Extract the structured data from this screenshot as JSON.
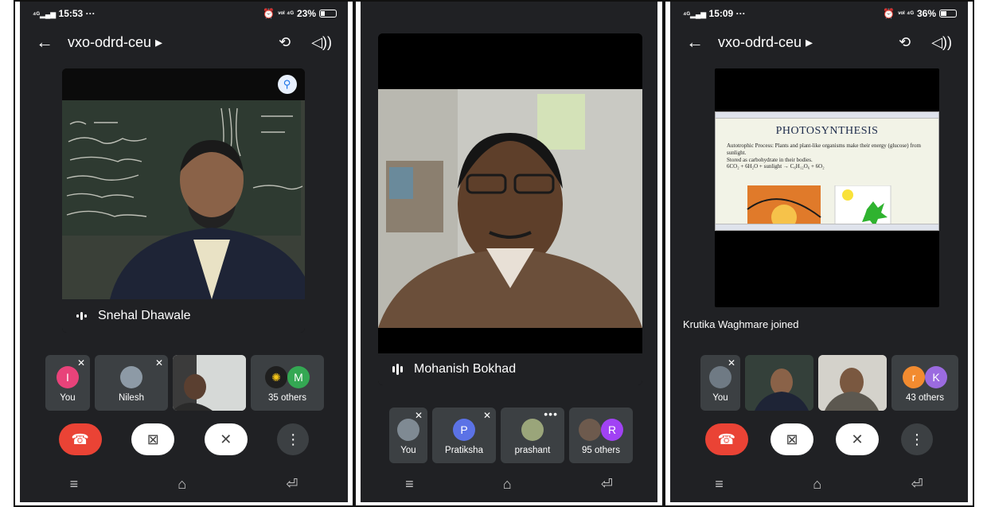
{
  "panels": [
    {
      "status": {
        "signal": "⁴ᴳ▂▄▆",
        "time": "15:53",
        "dots": "···",
        "alarm": "⏰",
        "lte": "ᵛᵒˡ ⁴ᴳ",
        "battery": "23%"
      },
      "topbar": {
        "back_icon": "←",
        "meeting_code": "vxo-odrd-ceu ▸",
        "camera_switch_icon": "⟲",
        "speaker_icon": "◁))"
      },
      "main_video": {
        "speaker_name": "Snehal Dhawale",
        "pin_icon": "⚲",
        "colors": {
          "background": "#3a3f3b",
          "board": "#2f3a33",
          "suit": "#1d2233"
        }
      },
      "participants": [
        {
          "label": "You",
          "avatar_letter": "I",
          "avatar_color": "#e8437a"
        },
        {
          "label": "Nilesh"
        },
        {
          "label": ""
        },
        {
          "label": "35 others",
          "avatar_letter": "M",
          "avatar_color": "#34a853"
        }
      ],
      "controls": {
        "end_icon": "☎",
        "camera_off_icon": "⊠",
        "mic_off_icon": "✕",
        "more_icon": "⋮"
      },
      "nav": {
        "menu_icon": "≡",
        "home_icon": "⌂",
        "back_icon": "⏎"
      }
    },
    {
      "main_video": {
        "speaker_name": "Mohanish Bokhad"
      },
      "participants": [
        {
          "label": "You"
        },
        {
          "label": "Pratiksha",
          "avatar_letter": "P",
          "avatar_color": "#5b72e6"
        },
        {
          "label": "prashant"
        },
        {
          "label": "95 others",
          "avatar_letter": "R",
          "avatar_color": "#a142f4"
        }
      ],
      "nav": {
        "menu_icon": "≡",
        "home_icon": "⌂",
        "back_icon": "⏎"
      }
    },
    {
      "status": {
        "signal": "⁴ᴳ▂▄▆",
        "time": "15:09",
        "dots": "···",
        "alarm": "⏰",
        "lte": "ᵛᵒˡ ⁴ᴳ",
        "battery": "36%"
      },
      "topbar": {
        "back_icon": "←",
        "meeting_code": "vxo-odrd-ceu ▸",
        "camera_switch_icon": "⟲",
        "speaker_icon": "◁))"
      },
      "slide": {
        "title": "PHOTOSYNTHESIS",
        "bullets": [
          "Autotrophic Process: Plants and plant-like organisms make their energy (glucose) from sunlight.",
          "Stored as carbohydrate in their bodies.",
          "6CO₂ + 6H₂O + sunlight → C₆H₁₂O₆ + 6O₂"
        ]
      },
      "toast": "Krutika Waghmare joined",
      "participants": [
        {
          "label": "You"
        },
        {
          "label": ""
        },
        {
          "label": ""
        },
        {
          "label": "43 others",
          "avatar_letter_1": "r",
          "avatar_color_1": "#f28b30",
          "avatar_letter_2": "K",
          "avatar_color_2": "#9b6be0"
        }
      ],
      "controls": {
        "end_icon": "☎",
        "camera_off_icon": "⊠",
        "mic_off_icon": "✕",
        "more_icon": "⋮"
      },
      "nav": {
        "menu_icon": "≡",
        "home_icon": "⌂",
        "back_icon": "⏎"
      }
    }
  ]
}
